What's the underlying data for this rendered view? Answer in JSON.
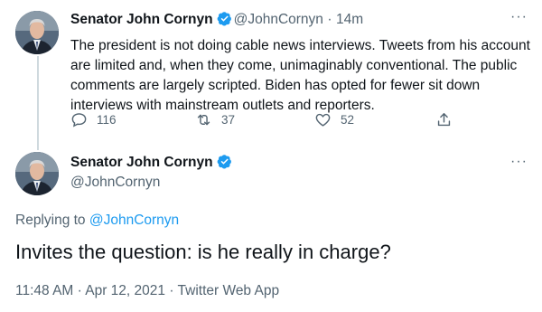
{
  "colors": {
    "accent": "#1d9bf0",
    "muted": "#536471",
    "text": "#0f1419",
    "line": "#cfd9de"
  },
  "tweet1": {
    "name": "Senator John Cornyn",
    "handle": "@JohnCornyn",
    "separator": "·",
    "time": "14m",
    "more": "···",
    "text": "The president is not doing cable news interviews. Tweets from his account are limited and, when they come, unimaginably conventional. The public comments are largely scripted. Biden has opted for fewer sit down interviews with mainstream outlets and reporters.",
    "replies": "116",
    "retweets": "37",
    "likes": "52"
  },
  "tweet2": {
    "name": "Senator John Cornyn",
    "handle": "@JohnCornyn",
    "more": "···",
    "replying_prefix": "Replying to",
    "replying_to": "@JohnCornyn",
    "text": "Invites the question: is he really in charge?",
    "timestamp": "11:48 AM · Apr 12, 2021 · Twitter Web App"
  }
}
